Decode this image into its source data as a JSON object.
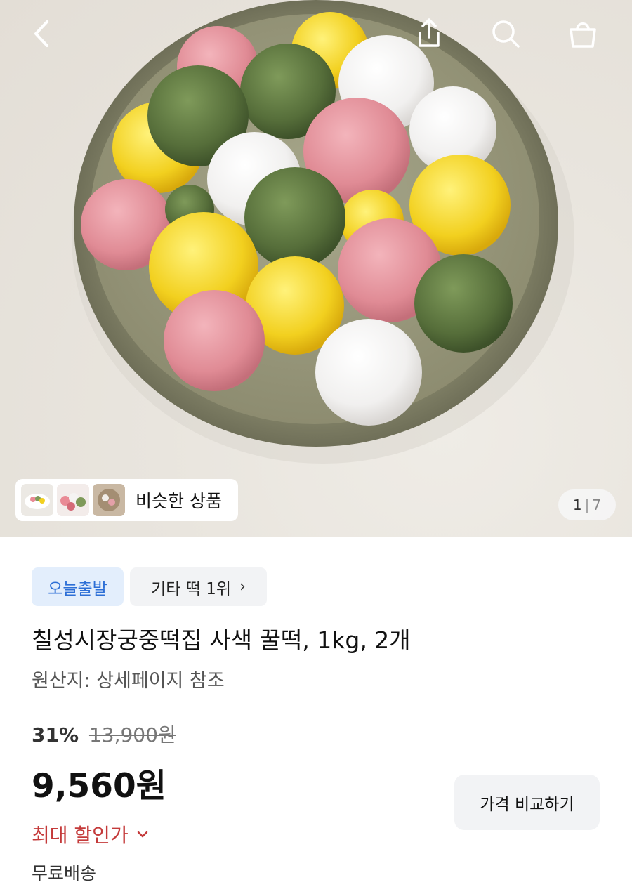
{
  "hero": {
    "image_alt": "",
    "similar_products_label": "비슷한 상품",
    "page_current": "1",
    "page_total": "7"
  },
  "topbar": {
    "back_icon": "chevron-left-icon",
    "share_icon": "share-icon",
    "search_icon": "search-icon",
    "cart_icon": "shopping-bag-icon"
  },
  "product": {
    "badge_delivery": "오늘출발",
    "badge_rank": "기타 떡 1위",
    "title": "칠성시장궁중떡집 사색 꿀떡, 1kg, 2개",
    "origin": "원산지: 상세페이지 참조",
    "discount_rate": "31%",
    "original_price": "13,900원",
    "sale_price": "9,560원",
    "max_discount_label": "최대 할인가",
    "compare_button_label": "가격 비교하기",
    "shipping": "무료배송"
  },
  "colors": {
    "accent_blue": "#2d6fd6",
    "badge_blue_bg": "#e3eefc",
    "discount_red": "#c43a3a"
  }
}
